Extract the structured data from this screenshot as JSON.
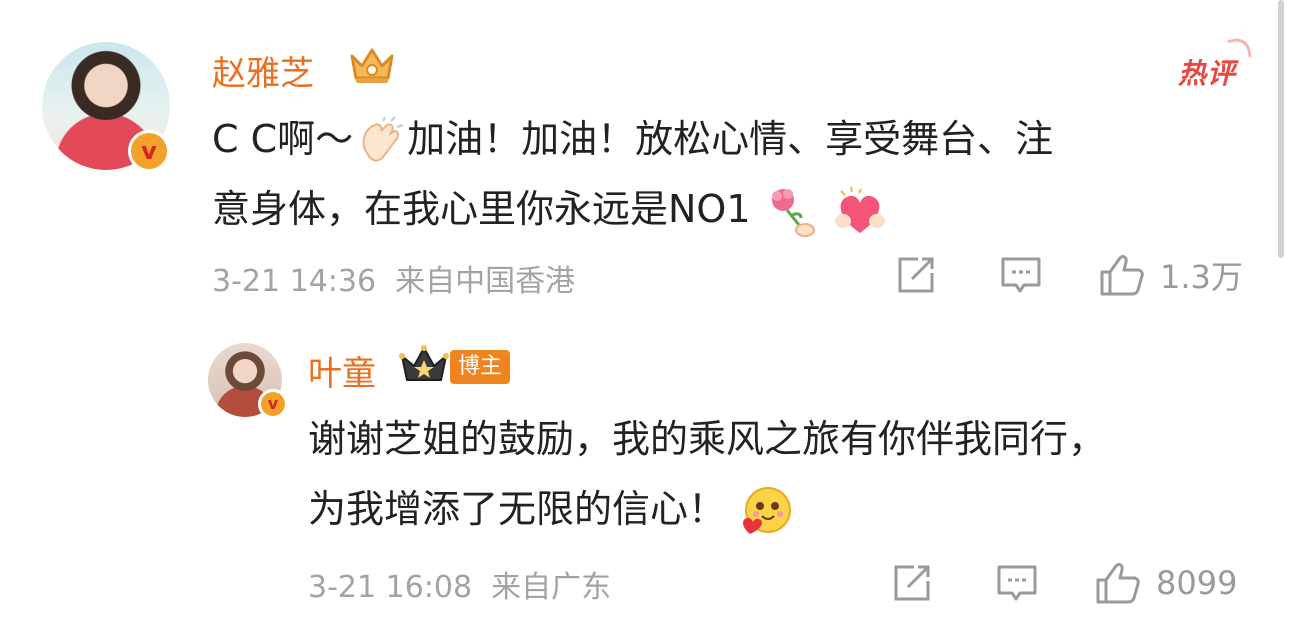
{
  "hot_label": "热评",
  "comment": {
    "author": "赵雅芝",
    "verified_badge": "v",
    "text_line1": "C C啊～",
    "text_line1_b": "加油！加油！放松心情、享受舞台、注",
    "text_line2": "意身体，在我心里你永远是NO1",
    "time": "3-21 14:36",
    "location": "来自中国香港",
    "likes": "1.3万",
    "icons": {
      "clap": "clap-emoji",
      "flower": "flower-emoji",
      "heart": "heart-hands-emoji"
    }
  },
  "reply": {
    "author": "叶童",
    "role": "博主",
    "verified_badge": "v",
    "text_line1": "谢谢芝姐的鼓励，我的乘风之旅有你伴我同行，",
    "text_line2": "为我增添了无限的信心！",
    "time": "3-21 16:08",
    "location": "来自广东",
    "likes": "8099",
    "icons": {
      "love": "love-face-emoji"
    }
  },
  "colors": {
    "accent": "#eb6f1f",
    "hot": "#e8483f",
    "meta": "#a3a3a3"
  }
}
